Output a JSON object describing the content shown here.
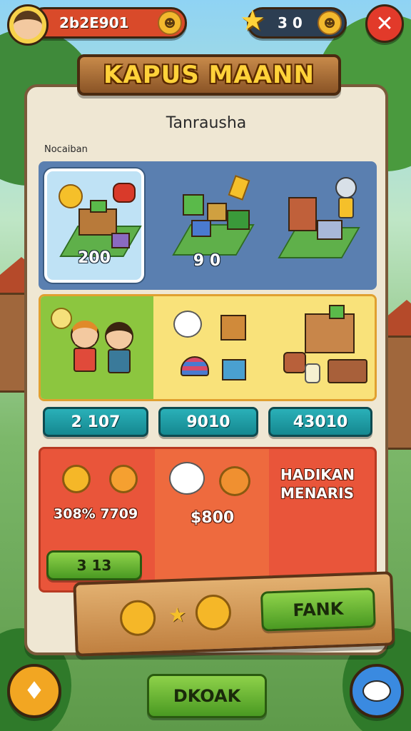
{
  "hud": {
    "coins_value": "2b2E901",
    "stars_value": "3 0"
  },
  "title": "KAPUS MAANN",
  "panel": {
    "subtitle": "Tanrausha",
    "section_label": "Nocaiban"
  },
  "row1": {
    "cards": [
      {
        "value": "200"
      },
      {
        "value": "9 0"
      },
      {
        "value": ""
      }
    ]
  },
  "row2_buttons": [
    "2 107",
    "9010",
    "43010"
  ],
  "row3": {
    "left_value": "308% 7709",
    "mid_value": "$800",
    "right_label_line1": "HADIKAN",
    "right_label_line2": "MENARIS",
    "button_label": "3 13"
  },
  "wood_board": {
    "fank_label": "FANK"
  },
  "bottom": {
    "center_button_label": "DKOAK"
  },
  "colors": {
    "panel": "#efe7d3",
    "row1_bg": "#5a7fb0",
    "row3_bg": "#e9553a",
    "teal": "#2ab0b8",
    "green_btn": "#6ab83a"
  }
}
